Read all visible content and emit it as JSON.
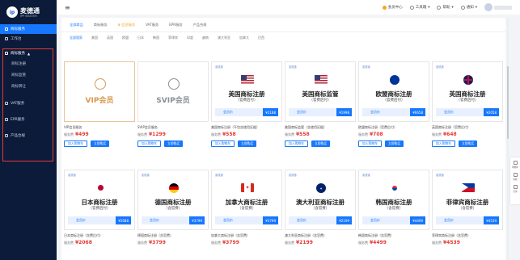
{
  "brand": {
    "name_cn": "麦德通",
    "name_en": "IPP MASTER"
  },
  "sidebar": {
    "items": [
      {
        "label": "商标服务"
      },
      {
        "label": "工作台"
      },
      {
        "label": "商标服务"
      },
      {
        "label": "VAT服务"
      },
      {
        "label": "EPR服务"
      },
      {
        "label": "产品合规"
      }
    ],
    "sub_items": [
      {
        "label": "商标注册"
      },
      {
        "label": "商标监管"
      },
      {
        "label": "商标转让"
      }
    ]
  },
  "topbar": {
    "items": [
      {
        "label": "会员中心"
      },
      {
        "label": "工具箱"
      },
      {
        "label": "帮助"
      },
      {
        "label": "通知"
      }
    ]
  },
  "tabs": [
    {
      "label": "全部商品"
    },
    {
      "label": "商标服务"
    },
    {
      "label": "会员服务"
    },
    {
      "label": "VAT服务"
    },
    {
      "label": "EPR服务"
    },
    {
      "label": "产品合规"
    }
  ],
  "countries": [
    "全部国家",
    "美国",
    "英国",
    "欧盟",
    "日本",
    "韩国",
    "菲律宾",
    "印度",
    "越南",
    "澳大利亚",
    "加拿大",
    "巴西"
  ],
  "cards_row1": [
    {
      "kind": "vip",
      "vip_label": "VIP会员",
      "name": "VIP会员服务",
      "price_prefix": "服务费",
      "price": "¥499",
      "btn1": "加入购物车",
      "btn2": "立即购买"
    },
    {
      "kind": "svip",
      "vip_label": "SVIP会员",
      "name": "SVIP会员服务",
      "price_prefix": "服务费",
      "price": "¥1299",
      "btn1": "加入购物车",
      "btn2": "立即购买"
    },
    {
      "kind": "tm",
      "brand": "麦德通",
      "title": "美国商标注册",
      "sub": "（官费后付）",
      "promo": "会员价",
      "promo_price": "¥2188",
      "name": "美国商标注册（不包含使用证据）",
      "price_prefix": "服务费",
      "price": "¥558",
      "btn1": "加入购物车",
      "btn2": "立即购买",
      "flag": "us"
    },
    {
      "kind": "tm",
      "brand": "麦德通",
      "title": "美国商标监管",
      "sub": "（官费后付）",
      "promo": "会员价",
      "promo_price": "¥1998",
      "name": "美国商标监管（含使用证据）",
      "price_prefix": "服务费",
      "price": "¥558",
      "btn1": "加入购物车",
      "btn2": "立即购买",
      "flag": "us"
    },
    {
      "kind": "tm",
      "brand": "麦德通",
      "title": "欧盟商标注册",
      "sub": "（官费后付）",
      "promo": "会员价",
      "promo_price": "¥6658",
      "name": "欧盟商标注册（官费后付）",
      "price_prefix": "服务费",
      "price": "¥708",
      "btn1": "加入购物车",
      "btn2": "立即购买",
      "flag": "eu"
    },
    {
      "kind": "tm",
      "brand": "麦德通",
      "title": "英国商标注册",
      "sub": "（官费后付）",
      "promo": "会员价",
      "promo_price": "¥2058",
      "name": "英国商标注册（官费后付）",
      "price_prefix": "服务费",
      "price": "¥648",
      "btn1": "加入购物车",
      "btn2": "立即购买",
      "flag": "uk"
    }
  ],
  "cards_row2": [
    {
      "brand": "麦德通",
      "title": "日本商标注册",
      "sub": "（官费后付）",
      "promo": "会员价",
      "promo_price": "¥2688",
      "name": "日本商标注册（含费后付）",
      "price_prefix": "服务费",
      "price": "¥2068",
      "flag": "jp"
    },
    {
      "brand": "麦德通",
      "title": "德国商标注册",
      "sub": "（含官费）",
      "promo": "会员价",
      "promo_price": "¥3799",
      "name": "德国商标注册（含官费）",
      "price_prefix": "服务费",
      "price": "¥3799",
      "flag": "de"
    },
    {
      "brand": "麦德通",
      "title": "加拿大商标注册",
      "sub": "（含官费）",
      "promo": "会员价",
      "promo_price": "¥3799",
      "name": "加拿大商标注册（含官费）",
      "price_prefix": "服务费",
      "price": "¥3799",
      "flag": "ca"
    },
    {
      "brand": "麦德通",
      "title": "澳大利亚商标注册",
      "sub": "（含官费）",
      "promo": "会员价",
      "promo_price": "¥2199",
      "name": "澳大利亚商标注册（含官费）",
      "price_prefix": "服务费",
      "price": "¥2199",
      "flag": "au"
    },
    {
      "brand": "麦德通",
      "title": "韩国商标注册",
      "sub": "（含官费）",
      "promo": "会员价",
      "promo_price": "¥4499",
      "name": "韩国商标注册（含官费）",
      "price_prefix": "服务费",
      "price": "¥4499",
      "flag": "kr"
    },
    {
      "brand": "麦德通",
      "title": "菲律宾商标注册",
      "sub": "（含官费）",
      "promo": "会员价",
      "promo_price": "¥4539",
      "name": "菲律宾商标注册（含官费）",
      "price_prefix": "服务费",
      "price": "¥4539",
      "flag": "ph"
    }
  ],
  "float_tools": [
    {
      "label": "购物车"
    },
    {
      "label": "客服"
    },
    {
      "label": "咨询"
    }
  ],
  "colors": {
    "accent": "#1677ff",
    "price": "#e53935",
    "gold": "#d79a4f",
    "sidebar_bg": "#0c1b3a",
    "highlight_border": "#e53935"
  }
}
